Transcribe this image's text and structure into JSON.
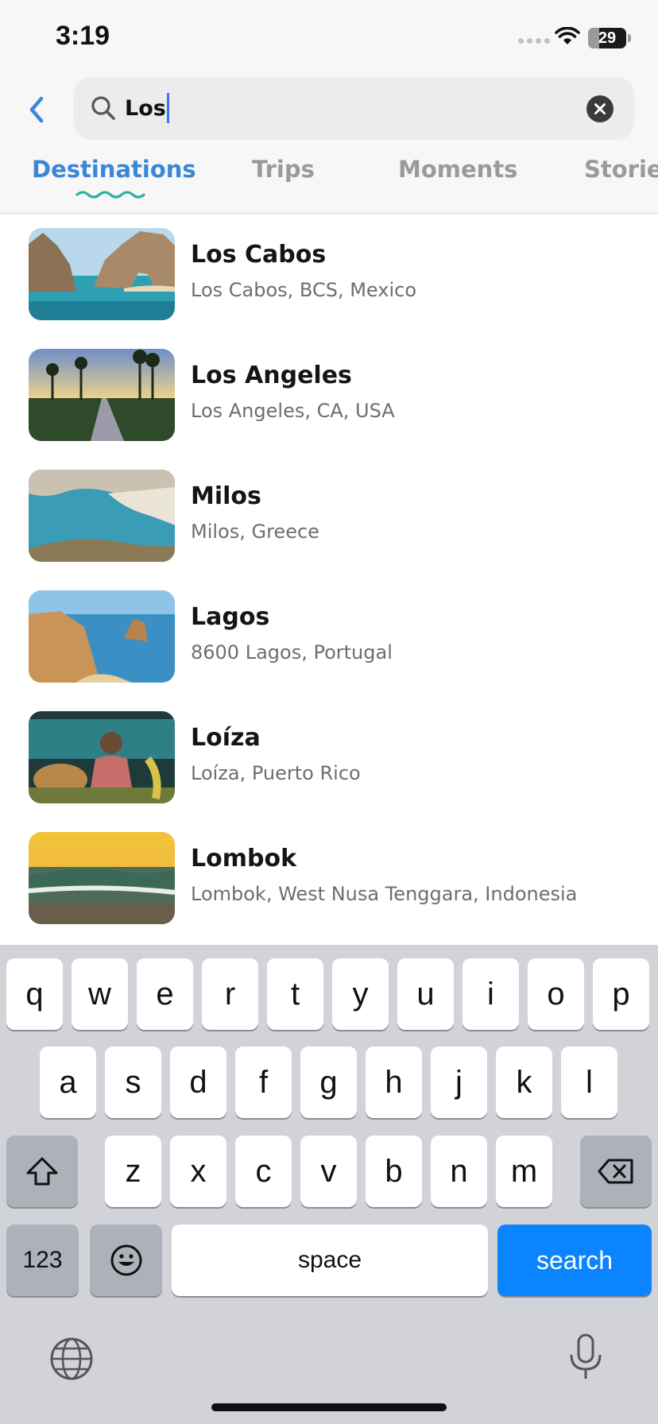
{
  "status": {
    "time": "3:19",
    "battery": "29",
    "battery_level": 0.29
  },
  "search": {
    "query": "Los"
  },
  "tabs": [
    {
      "label": "Destinations",
      "active": true
    },
    {
      "label": "Trips",
      "active": false
    },
    {
      "label": "Moments",
      "active": false
    },
    {
      "label": "Storie",
      "active": false
    }
  ],
  "results": [
    {
      "title": "Los Cabos",
      "subtitle": "Los Cabos, BCS, Mexico"
    },
    {
      "title": "Los Angeles",
      "subtitle": "Los Angeles, CA, USA"
    },
    {
      "title": "Milos",
      "subtitle": "Milos, Greece"
    },
    {
      "title": "Lagos",
      "subtitle": "8600 Lagos, Portugal"
    },
    {
      "title": "Loíza",
      "subtitle": "Loíza, Puerto Rico"
    },
    {
      "title": "Lombok",
      "subtitle": "Lombok, West Nusa Tenggara, Indonesia"
    }
  ],
  "keyboard": {
    "row1": [
      "q",
      "w",
      "e",
      "r",
      "t",
      "y",
      "u",
      "i",
      "o",
      "p"
    ],
    "row2": [
      "a",
      "s",
      "d",
      "f",
      "g",
      "h",
      "j",
      "k",
      "l"
    ],
    "row3": [
      "z",
      "x",
      "c",
      "v",
      "b",
      "n",
      "m"
    ],
    "numbers_label": "123",
    "space_label": "space",
    "search_label": "search"
  },
  "colors": {
    "accent": "#3a86d8",
    "keyboard_action": "#0a84ff",
    "squiggle": "#2bb39a"
  }
}
